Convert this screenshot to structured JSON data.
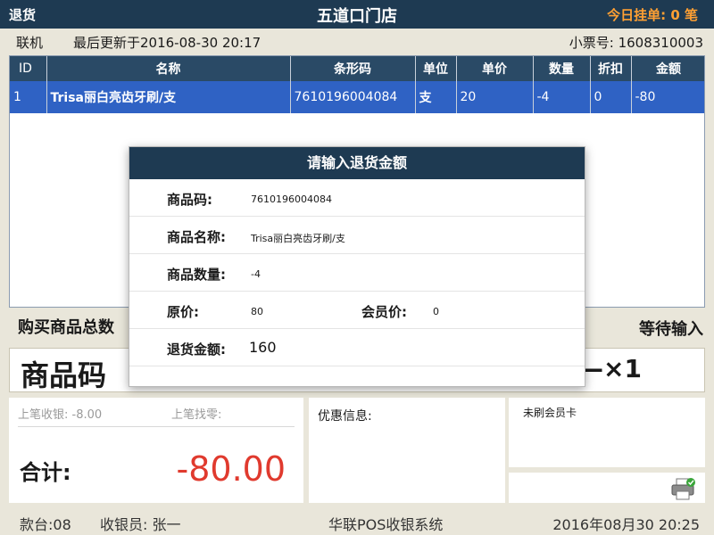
{
  "titlebar": {
    "mode": "退货",
    "store": "五道口门店",
    "hold_label": "今日挂单:",
    "hold_count": "0",
    "hold_unit": "笔"
  },
  "infobar": {
    "online": "联机",
    "updated": "最后更新于2016-08-30 20:17",
    "ticket_label": "小票号:",
    "ticket_no": "1608310003"
  },
  "grid": {
    "columns": [
      "ID",
      "名称",
      "条形码",
      "单位",
      "单价",
      "数量",
      "折扣",
      "金额"
    ],
    "rows": [
      [
        "1",
        "Trisa丽白亮齿牙刷/支",
        "7610196004084",
        "支",
        "20",
        "-4",
        "0",
        "-80"
      ]
    ]
  },
  "totals": {
    "total_label": "购买商品总数",
    "status": "等待输入"
  },
  "code": {
    "label": "商品码",
    "multiplier": "—×1"
  },
  "summary": {
    "last_paid_label": "上笔收银:",
    "last_paid": "-8.00",
    "last_change_label": "上笔找零:",
    "last_change": "",
    "total_label": "合计:",
    "total": "-80.00"
  },
  "promo": {
    "label": "优惠信息:"
  },
  "member": {
    "status": "未刷会员卡"
  },
  "footer": {
    "counter": "款台:08",
    "cashier": "收银员: 张一",
    "system": "华联POS收银系统",
    "datetime": "2016年08月30  20:25"
  },
  "dialog": {
    "title": "请输入退货金额",
    "barcode_label": "商品码:",
    "barcode": "7610196004084",
    "name_label": "商品名称:",
    "name": "Trisa丽白亮齿牙刷/支",
    "qty_label": "商品数量:",
    "qty": "-4",
    "price_label": "原价:",
    "price": "80",
    "member_price_label": "会员价:",
    "member_price": "0",
    "refund_label": "退货金额:",
    "refund_value": "160"
  },
  "colors": {
    "header_bg": "#1e3a52",
    "row_selected": "#2f62c4",
    "accent_orange": "#ffa033",
    "total_red": "#e03a2e"
  }
}
